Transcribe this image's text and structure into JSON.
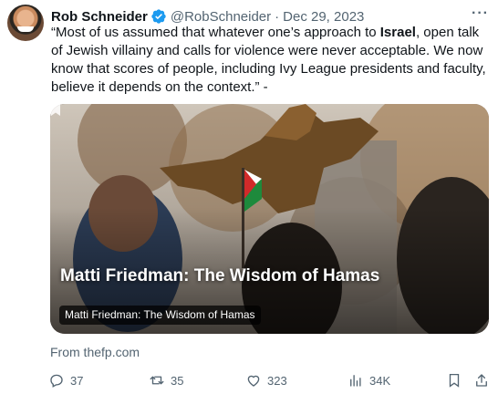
{
  "tweet": {
    "author_name": "Rob Schneider",
    "handle": "@RobSchneider",
    "separator": "·",
    "date": "Dec 29, 2023",
    "text_before": "“Most of us assumed that whatever one’s approach to ",
    "text_bold": "Israel",
    "text_after": ", open talk of Jewish villainy and calls for violence were never acceptable. We now know that scores of people, including Ivy League presidents and faculty, believe it depends on the context.” -"
  },
  "card": {
    "title": "Matti Friedman: The Wisdom of Hamas",
    "label": "Matti Friedman: The Wisdom of Hamas",
    "source": "From thefp.com"
  },
  "actions": {
    "replies": "37",
    "retweets": "35",
    "likes": "323",
    "views": "34K"
  },
  "colors": {
    "accent": "#1d9bf0",
    "muted": "#536471",
    "text": "#0f1419"
  },
  "icons": [
    "verified-badge-icon",
    "more-icon",
    "reply-icon",
    "retweet-icon",
    "like-icon",
    "views-icon",
    "bookmark-icon",
    "share-icon"
  ]
}
